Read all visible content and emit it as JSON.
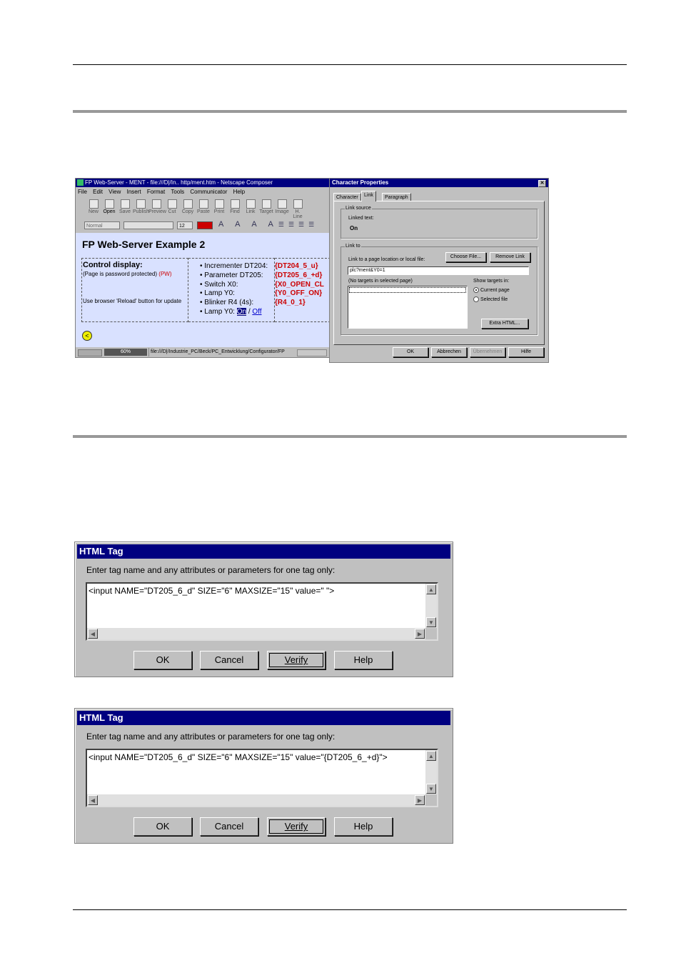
{
  "composer": {
    "title": "FP Web-Server - MENT - file:///D|/In.. http/ment.htm - Netscape Composer",
    "menu": [
      "File",
      "Edit",
      "View",
      "Insert",
      "Format",
      "Tools",
      "Communicator",
      "Help"
    ],
    "toolbar": [
      "New",
      "Open",
      "Save",
      "Publish",
      "Preview",
      "Cut",
      "Copy",
      "Paste",
      "Print",
      "Find",
      "Link",
      "Target",
      "Image",
      "H. Line"
    ],
    "style_select": "Normal",
    "font_size": "12",
    "page_heading": "FP Web-Server Example 2",
    "left": {
      "heading": "Control display:",
      "note1": "(Page is password protected)",
      "pw": "(PW)",
      "note2": "Use browser 'Reload' button for update"
    },
    "items": [
      {
        "label": "Incrementer DT204:",
        "value": "{DT204_5_u}"
      },
      {
        "label": "Parameter DT205:",
        "value": "{DT205_6_+d}"
      },
      {
        "label": "Switch X0:",
        "value": "{X0_OPEN_CL"
      },
      {
        "label": "Lamp Y0:",
        "value": "{Y0_OFF_ON}"
      },
      {
        "label": "Blinker R4 (4s):",
        "value": "{R4_0_1}"
      }
    ],
    "lamp_label": "Lamp Y0:",
    "lamp_on": "On",
    "lamp_sep": "/",
    "lamp_off": "Off",
    "status_percent": "60%",
    "status_path": "file:///D|/Industrie_PC/Beck/PC_Entwicklung/Configurator/FP"
  },
  "charprops": {
    "title": "Character Properties",
    "tabs": [
      "Character",
      "Link",
      "Paragraph"
    ],
    "link_source_legend": "Link source",
    "linked_text_label": "Linked text:",
    "linked_text": "On",
    "link_to_legend": "Link to",
    "link_to_label": "Link to a page location or local file:",
    "choose_file": "Choose File...",
    "remove_link": "Remove Link",
    "url_value": "plc?ment&Y0=1",
    "targets_label": "(No targets in selected page)",
    "show_targets": "Show targets in:",
    "radio_current": "Current page",
    "radio_selected": "Selected file",
    "extra_html": "Extra HTML...",
    "ok": "OK",
    "cancel": "Abbrechen",
    "apply": "Übernehmen",
    "help": "Hilfe"
  },
  "dialog1": {
    "title": "HTML Tag",
    "prompt": "Enter tag name and any attributes or parameters for one tag only:",
    "text": "<input NAME=\"DT205_6_d\" SIZE=\"6\"  MAXSIZE=\"15\" value=\" \">",
    "ok": "OK",
    "cancel": "Cancel",
    "verify": "Verify",
    "help": "Help"
  },
  "dialog2": {
    "title": "HTML Tag",
    "prompt": "Enter tag name and any attributes or parameters for one tag only:",
    "text": "<input NAME=\"DT205_6_d\" SIZE=\"6\"  MAXSIZE=\"15\" value=\"{DT205_6_+d}\">",
    "ok": "OK",
    "cancel": "Cancel",
    "verify": "Verify",
    "help": "Help"
  }
}
